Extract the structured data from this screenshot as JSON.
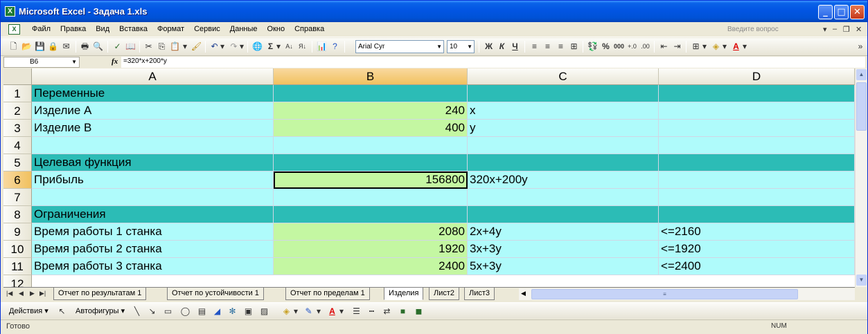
{
  "window": {
    "title": "Microsoft Excel - Задача 1.xls",
    "app_icon": "excel-icon"
  },
  "menu": {
    "items": [
      "Файл",
      "Правка",
      "Вид",
      "Вставка",
      "Формат",
      "Сервис",
      "Данные",
      "Окно",
      "Справка"
    ],
    "help_placeholder": "Введите вопрос"
  },
  "toolbar": {
    "font_name": "Arial Cyr",
    "font_size": "10",
    "bold": "Ж",
    "italic": "К",
    "underline": "Ч",
    "percent": "%",
    "thousands": "000"
  },
  "formula_bar": {
    "name_box": "B6",
    "fx": "fx",
    "formula": "=320*x+200*y"
  },
  "columns": [
    "A",
    "B",
    "C",
    "D"
  ],
  "selected_column": "B",
  "selected_row": 6,
  "rows": [
    {
      "n": "1",
      "a": "Переменные",
      "b": "",
      "c": "",
      "d": ""
    },
    {
      "n": "2",
      "a": "Изделие A",
      "b": "240",
      "c": "x",
      "d": ""
    },
    {
      "n": "3",
      "a": "Изделие B",
      "b": "400",
      "c": "y",
      "d": ""
    },
    {
      "n": "4",
      "a": "",
      "b": "",
      "c": "",
      "d": ""
    },
    {
      "n": "5",
      "a": "Целевая функция",
      "b": "",
      "c": "",
      "d": ""
    },
    {
      "n": "6",
      "a": "Прибыль",
      "b": "156800",
      "c": "320x+200y",
      "d": ""
    },
    {
      "n": "7",
      "a": "",
      "b": "",
      "c": "",
      "d": ""
    },
    {
      "n": "8",
      "a": "Ограничения",
      "b": "",
      "c": "",
      "d": ""
    },
    {
      "n": "9",
      "a": "Время работы 1 станка",
      "b": "2080",
      "c": "2x+4y",
      "d": "<=2160"
    },
    {
      "n": "10",
      "a": "Время работы 2 станка",
      "b": "1920",
      "c": "3x+3y",
      "d": "<=1920"
    },
    {
      "n": "11",
      "a": "Время работы 3 станка",
      "b": "2400",
      "c": "5x+3y",
      "d": "<=2400"
    },
    {
      "n": "12",
      "a": "",
      "b": "",
      "c": "",
      "d": ""
    }
  ],
  "colors": {
    "header_rows": "#2CBCB6",
    "data_rows": "#AFFBFB",
    "values_column": "#C4F7A2"
  },
  "sheet_tabs": [
    "Отчет по результатам 1",
    "Отчет по устойчивости 1",
    "Отчет по пределам 1",
    "Изделия",
    "Лист2",
    "Лист3"
  ],
  "active_tab": "Изделия",
  "drawing_toolbar": {
    "actions": "Действия",
    "autoshapes": "Автофигуры"
  },
  "status": {
    "text": "Готово",
    "num": "NUM"
  }
}
